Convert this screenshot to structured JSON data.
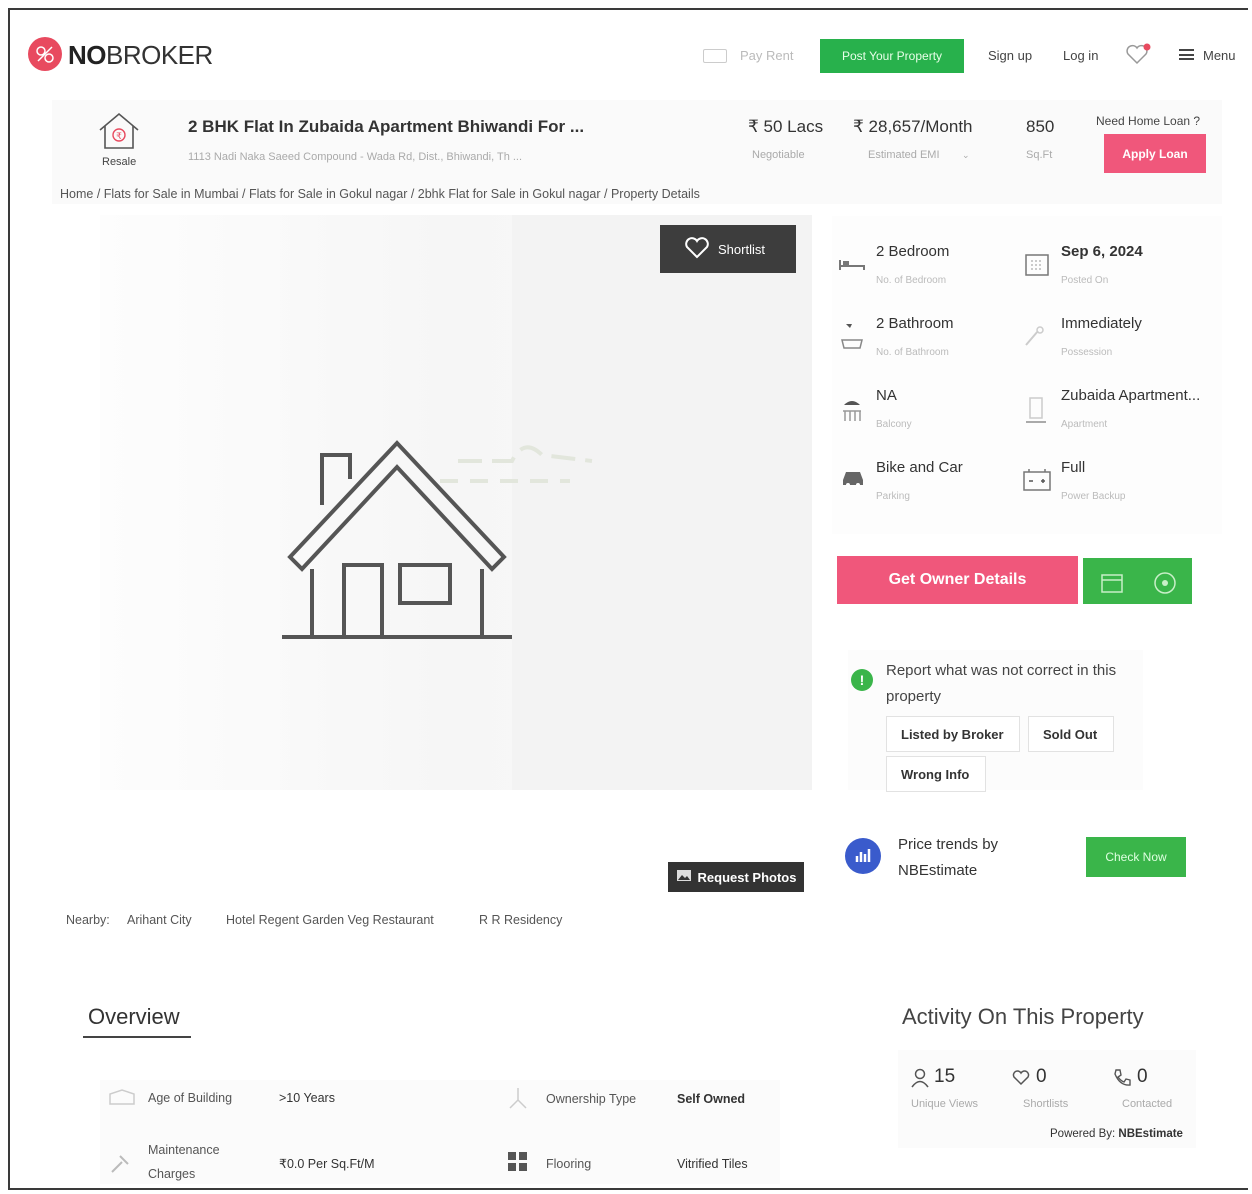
{
  "header": {
    "logo_text": "NOBROKER",
    "logo_bold": "NO",
    "logo_rest": "BROKER",
    "pay_rent": "Pay Rent",
    "post_property": "Post Your Property",
    "sign_up": "Sign up",
    "log_in": "Log in",
    "menu": "Menu"
  },
  "listing": {
    "tag": "Resale",
    "title": "2 BHK Flat In Zubaida Apartment Bhiwandi For ...",
    "address": "1113 Nadi Naka Saeed Compound - Wada Rd, Dist., Bhiwandi, Th ...",
    "price": "₹ 50 Lacs",
    "price_note": "Negotiable",
    "emi": "₹ 28,657/Month",
    "emi_note": "Estimated EMI",
    "area": "850",
    "area_unit": "Sq.Ft",
    "loan_question": "Need Home Loan ?",
    "apply_loan": "Apply Loan"
  },
  "breadcrumb": "Home / Flats for Sale in Mumbai / Flats for Sale in Gokul nagar / 2bhk Flat for Sale in Gokul nagar / Property Details",
  "photo": {
    "shortlist": "Shortlist",
    "request_photos": "Request Photos"
  },
  "nearby": {
    "label": "Nearby:",
    "places": [
      "Arihant City",
      "Hotel Regent Garden Veg Restaurant",
      "R R Residency"
    ]
  },
  "details": [
    {
      "value": "2 Bedroom",
      "label": "No. of Bedroom",
      "icon": "bed-icon"
    },
    {
      "value": "Sep 6, 2024",
      "label": "Posted On",
      "icon": "calendar-icon"
    },
    {
      "value": "2 Bathroom",
      "label": "No. of Bathroom",
      "icon": "bath-icon"
    },
    {
      "value": "Immediately",
      "label": "Possession",
      "icon": "key-icon"
    },
    {
      "value": "NA",
      "label": "Balcony",
      "icon": "balcony-icon"
    },
    {
      "value": "Zubaida Apartment...",
      "label": "Apartment",
      "icon": "building-icon"
    },
    {
      "value": "Bike and Car",
      "label": "Parking",
      "icon": "car-icon"
    },
    {
      "value": "Full",
      "label": "Power Backup",
      "icon": "battery-icon"
    }
  ],
  "actions": {
    "get_owner": "Get Owner Details"
  },
  "report": {
    "text": "Report what was not correct in this property",
    "chips": [
      "Listed by Broker",
      "Sold Out",
      "Wrong Info"
    ]
  },
  "trends": {
    "text1": "Price trends by",
    "text2": "NBEstimate",
    "check_now": "Check Now"
  },
  "overview": {
    "title": "Overview",
    "rows": [
      {
        "key": "Age of Building",
        "value": ">10 Years"
      },
      {
        "key": "Ownership Type",
        "value": "Self Owned"
      },
      {
        "key": "Maintenance",
        "key2": "Charges",
        "value": "₹0.0 Per Sq.Ft/M"
      },
      {
        "key": "Flooring",
        "value": "Vitrified Tiles"
      }
    ]
  },
  "activity": {
    "title": "Activity On This Property",
    "stats": [
      {
        "value": "15",
        "label": "Unique Views"
      },
      {
        "value": "0",
        "label": "Shortlists"
      },
      {
        "value": "0",
        "label": "Contacted"
      }
    ],
    "powered_by": "Powered By:",
    "powered_name": "NBEstimate"
  },
  "colors": {
    "brand_red": "#e84a5f",
    "pink_button": "#f0577b",
    "green_button": "#3ab54a",
    "trend_blue": "#3a5bcc"
  }
}
